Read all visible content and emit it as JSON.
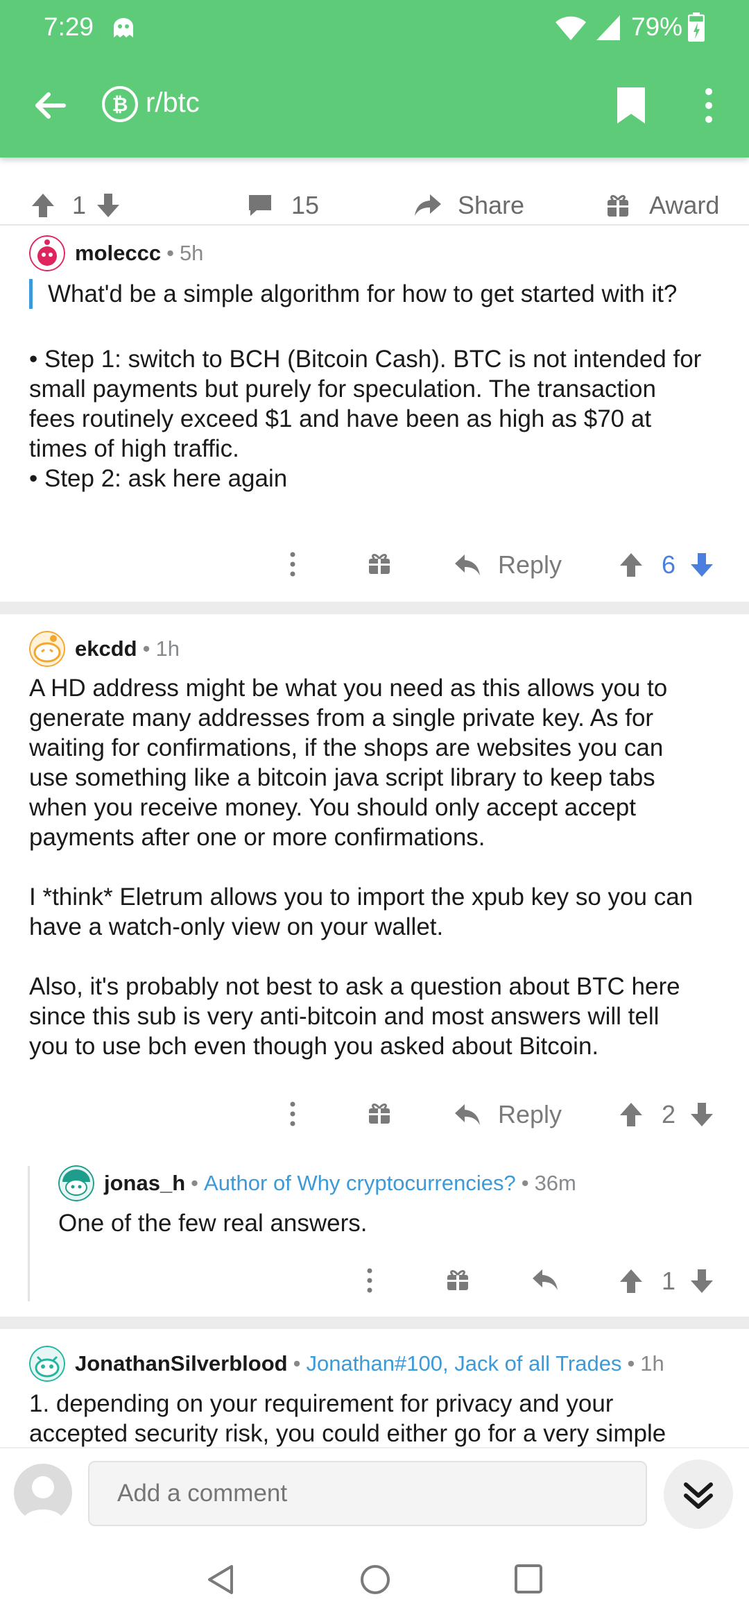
{
  "status": {
    "time": "7:29",
    "battery": "79%"
  },
  "header": {
    "subreddit": "r/btc"
  },
  "post_actions": {
    "score": "1",
    "comments": "15",
    "share": "Share",
    "award": "Award"
  },
  "comments": [
    {
      "user": "moleccc",
      "time": "5h",
      "quote": "What'd be a simple algorithm for how to get started with it?",
      "body": [
        "• Step 1: switch to BCH (Bitcoin Cash). BTC is not intended for",
        "small payments but purely for speculation. The transaction",
        "fees routinely exceed $1 and have been as high as $70 at",
        "times of high traffic.",
        "• Step 2: ask here again"
      ],
      "reply": "Reply",
      "score": "6"
    },
    {
      "user": "ekcdd",
      "time": "1h",
      "body": [
        "A HD address might be what you need as this allows you to",
        "generate many addresses from a single private key. As for",
        "waiting for confirmations,  if the shops are websites you can",
        "use something like a bitcoin java script library to keep tabs",
        "when you receive money.  You should only accept accept",
        "payments after one  or more confirmations.",
        "",
        "I *think* Eletrum allows you to import the xpub key so you can",
        "have a watch-only view on your wallet.",
        "",
        "Also, it's probably not best to ask a question about BTC here",
        "since this sub is very anti-bitcoin and most answers will tell",
        "you to use bch even though you asked about Bitcoin."
      ],
      "reply": "Reply",
      "score": "2"
    },
    {
      "user": "jonas_h",
      "flair": "Author of Why cryptocurrencies?",
      "time": "36m",
      "body": [
        "One of the few real answers."
      ],
      "score": "1"
    },
    {
      "user": "JonathanSilverblood",
      "flair": "Jonathan#100, Jack of all Trades",
      "time": "1h",
      "body": [
        "1. depending on your requirement for privacy and your",
        "accepted security risk, you could either go for a very simple"
      ]
    }
  ],
  "comment_bar": {
    "placeholder": "Add a comment"
  },
  "colors": {
    "brand_green": "#5ecb78",
    "link_blue": "#3d9ad8",
    "upvoted_blue": "#4a7fe0"
  }
}
